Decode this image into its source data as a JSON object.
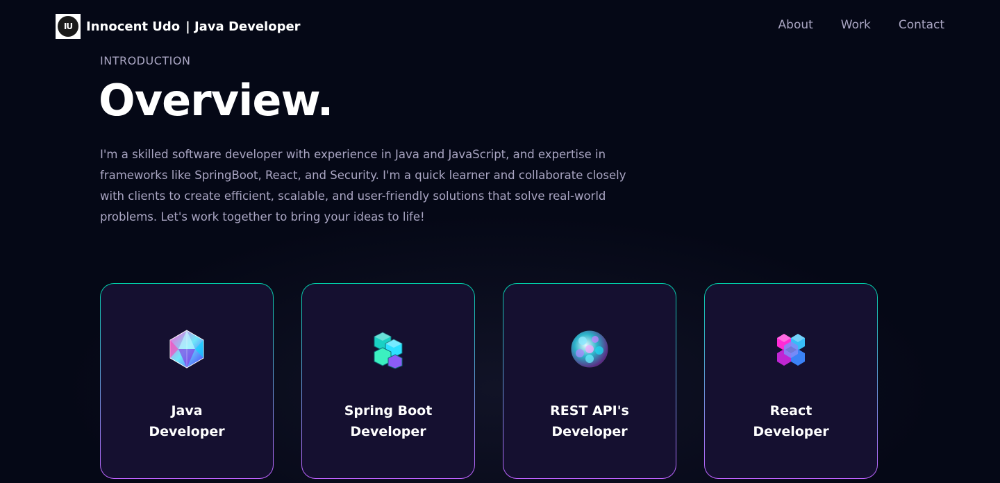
{
  "nav": {
    "logo_text": "IU",
    "brand_name": "Innocent Udo",
    "brand_role": "| Java Developer",
    "links": [
      "About",
      "Work",
      "Contact"
    ]
  },
  "overview": {
    "subtitle": "INTRODUCTION",
    "title": "Overview.",
    "description": "I'm a skilled software developer with experience in Java and JavaScript, and expertise in frameworks like SpringBoot, React, and Security. I'm a quick learner and collaborate closely with clients to create efficient, scalable, and user-friendly solutions that solve real-world problems. Let's work together to bring your ideas to life!"
  },
  "services": [
    {
      "line1": "Java",
      "line2": "Developer",
      "icon": "crystal-icosahedron-icon"
    },
    {
      "line1": "Spring Boot",
      "line2": "Developer",
      "icon": "cube-cluster-icon"
    },
    {
      "line1": "REST API's",
      "line2": "Developer",
      "icon": "sphere-mesh-icon"
    },
    {
      "line1": "React",
      "line2": "Developer",
      "icon": "hex-cubes-icon"
    }
  ],
  "colors": {
    "background": "#050816",
    "secondary_text": "#aaa6c3",
    "card_bg": "#151030",
    "card_border_top": "#00cea8",
    "card_border_bottom": "#bf61ff"
  }
}
